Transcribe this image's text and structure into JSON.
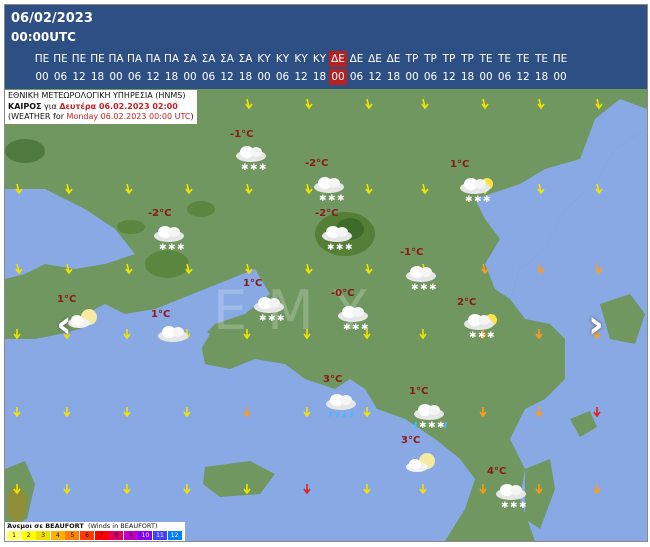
{
  "header": {
    "date": "06/02/2023",
    "utc": "00:00UTC",
    "days": [
      "ΠΕ",
      "ΠΕ",
      "ΠΕ",
      "ΠΕ",
      "ΠΑ",
      "ΠΑ",
      "ΠΑ",
      "ΠΑ",
      "ΣΑ",
      "ΣΑ",
      "ΣΑ",
      "ΣΑ",
      "ΚΥ",
      "ΚΥ",
      "ΚΥ",
      "ΚΥ",
      "ΔΕ",
      "ΔΕ",
      "ΔΕ",
      "ΔΕ",
      "ΤΡ",
      "ΤΡ",
      "ΤΡ",
      "ΤΡ",
      "ΤΕ",
      "ΤΕ",
      "ΤΕ",
      "ΤΕ",
      "ΠΕ"
    ],
    "hours": [
      "00",
      "06",
      "12",
      "18",
      "00",
      "06",
      "12",
      "18",
      "00",
      "06",
      "12",
      "18",
      "00",
      "06",
      "12",
      "18",
      "00",
      "06",
      "12",
      "18",
      "00",
      "06",
      "12",
      "18",
      "00",
      "06",
      "12",
      "18",
      "00"
    ],
    "selected_index": 16
  },
  "info": {
    "line1": "ΕΘΝΙΚΗ ΜΕΤΕΩΡΟΛΟΓΙΚΗ ΥΠΗΡΕΣΙΑ (HNMS)",
    "line2_a": "ΚΑΙΡΟΣ",
    "line2_b": " για ",
    "line2_c": "Δευτέρα 06.02.2023 02:00",
    "line3_a": "(WEATHER for ",
    "line3_b": "Monday 06.02.2023 00:00 UTC",
    "line3_c": ")"
  },
  "watermark": "EMY",
  "temperatures": [
    "-1°C",
    "-2°C",
    "1°C",
    "-2°C",
    "-2°C",
    "-1°C",
    "1°C",
    "1°C",
    "-0°C",
    "2°C",
    "1°C",
    "3°C",
    "1°C",
    "3°C",
    "4°C"
  ],
  "nav": {
    "prev": "‹",
    "next": "›"
  },
  "legend": {
    "title": "Άνεμοι σε BEAUFORT",
    "title_en": "(Winds in BEAUFORT)",
    "levels": [
      "1",
      "2",
      "3",
      "4",
      "5",
      "6",
      "7",
      "8",
      "9",
      "10",
      "11",
      "12"
    ],
    "colors": [
      "#ffff66",
      "#ffff00",
      "#f0e000",
      "#ffb000",
      "#ff7f00",
      "#ff3c00",
      "#ff0000",
      "#e00060",
      "#c000c0",
      "#8000ff",
      "#4040ff",
      "#0080ff"
    ]
  },
  "colors": {
    "header_bg": "#2d4f84",
    "selected": "#b52020",
    "sea": "#88a9e4",
    "land": "#6f975f",
    "temp_text": "#8b1a1a"
  }
}
